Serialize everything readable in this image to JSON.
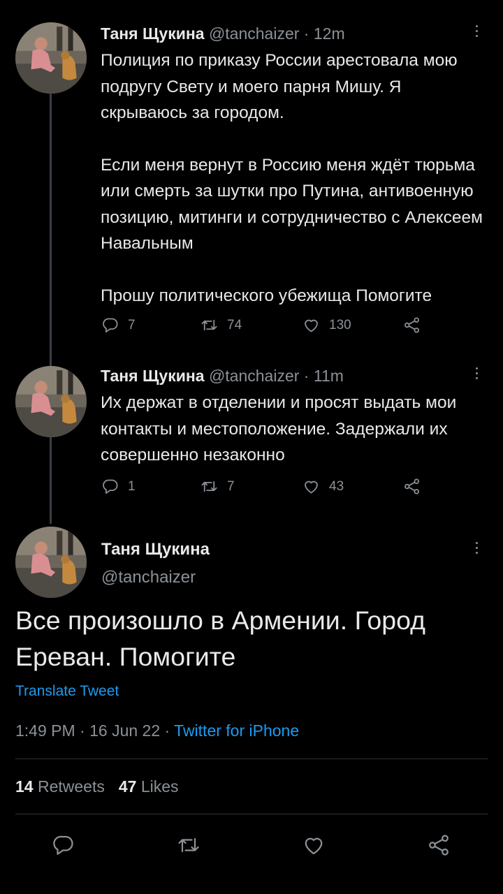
{
  "tweets": [
    {
      "name": "Таня Щукина",
      "handle": "@tanchaizer",
      "time": "12m",
      "paragraphs": [
        "Полиция по приказу России арестовала мою подругу Свету и моего парня Мишу. Я скрываюсь за городом.",
        "Если меня вернут в Россию меня ждёт тюрьма или смерть за шутки про Путина, антивоенную позицию, митинги и сотрудничество с Алексеем Навальным",
        "Прошу политического убежища Помогите"
      ],
      "replies": "7",
      "retweets": "74",
      "likes": "130"
    },
    {
      "name": "Таня Щукина",
      "handle": "@tanchaizer",
      "time": "11m",
      "paragraphs": [
        "Их держат в отделении и просят выдать мои контакты и местоположение. Задержали их совершенно незаконно"
      ],
      "replies": "1",
      "retweets": "7",
      "likes": "43"
    }
  ],
  "main_tweet": {
    "name": "Таня Щукина",
    "handle": "@tanchaizer",
    "text": "Все произошло в Армении. Город Ереван. Помогите",
    "translate_label": "Translate Tweet",
    "time": "1:49 PM",
    "date": "16 Jun 22",
    "source": "Twitter for iPhone",
    "retweets_count": "14",
    "retweets_label": "Retweets",
    "likes_count": "47",
    "likes_label": "Likes"
  },
  "separator": " · ",
  "colors": {
    "background": "#000000",
    "text": "#e7e9ea",
    "muted": "#8b9197",
    "accent": "#1d9bf0"
  },
  "icons": [
    "reply-icon",
    "retweet-icon",
    "like-icon",
    "share-icon",
    "more-icon"
  ]
}
